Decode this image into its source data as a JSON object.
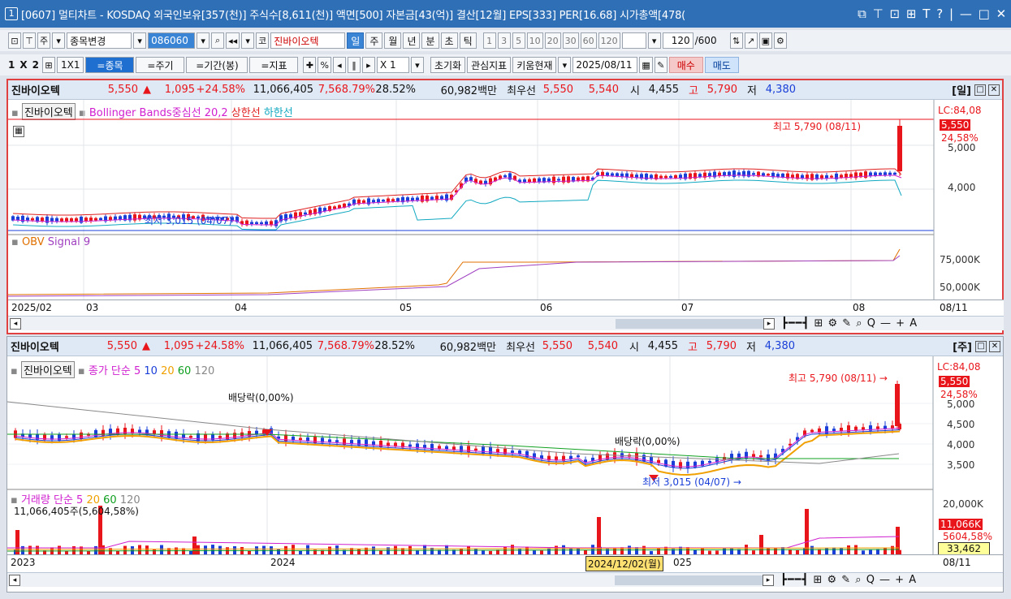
{
  "window": {
    "num": "1",
    "title": "[0607] 멀티차트 - KOSDAQ 외국인보유[357(천)] 주식수[8,611(천)] 액면[500] 자본금[43(억)] 결산[12월] EPS[333] PER[16.68] 시가총액[478(",
    "controls": [
      "⧉",
      "⊤",
      "⊡",
      "⊞",
      "T",
      "?",
      "|",
      "—",
      "□",
      "✕"
    ]
  },
  "toolbar1": {
    "market": "주",
    "change_label": "종목변경",
    "code": "086060",
    "market_btn": "코",
    "stock_name": "진바이오텍",
    "periods": [
      "일",
      "주",
      "월",
      "년",
      "분",
      "초",
      "틱"
    ],
    "active_period": "일",
    "numbers": [
      "1",
      "3",
      "5",
      "10",
      "20",
      "30",
      "60",
      "120"
    ],
    "count": "120",
    "count_total": "/600"
  },
  "toolbar2": {
    "layout": [
      "1",
      "X",
      "2"
    ],
    "onebyone": "1X1",
    "eq_stock": "=종목",
    "eq_period": "=주기",
    "eq_range": "=기간(봉)",
    "eq_indicator": "=지표",
    "percent": "%",
    "multiplier": "X 1",
    "reset": "초기화",
    "watch": "관심지표",
    "kiwoom": "키움현재",
    "date": "2025/08/11",
    "buy": "매수",
    "sell": "매도"
  },
  "quote": {
    "name": "진바이오텍",
    "price": "5,550",
    "arrow": "▲",
    "change": "1,095",
    "pct": "+24.58%",
    "volume": "11,066,405",
    "vol_ratio": "7,568.79%",
    "turnover": "28.52%",
    "amount": "60,982백만",
    "best_label": "최우선",
    "best_ask": "5,550",
    "best_bid": "5,540",
    "open_label": "시",
    "open": "4,455",
    "high_label": "고",
    "high": "5,790",
    "low_label": "저",
    "low": "4,380"
  },
  "panel1": {
    "period_tag": "[일]",
    "legend_name": "진바이오텍",
    "legend_bb": "Bollinger Bands중심선 20,2",
    "legend_upper": "상한선",
    "legend_lower": "하한선",
    "lc_label": "LC:84,08",
    "price_tag": "5,550",
    "pct_tag": "24,58%",
    "y_labels": [
      "5,000",
      "4,000"
    ],
    "max_note": "최고 5,790 (08/11)",
    "min_note": "최저 3,015 (04/07)",
    "obv_label": "OBV",
    "signal_label": "Signal 9",
    "obv_y": [
      "75,000K",
      "50,000K"
    ],
    "x_labels": [
      "2025/02",
      "03",
      "04",
      "05",
      "06",
      "07",
      "08",
      "08/11"
    ]
  },
  "panel2": {
    "period_tag": "[주]",
    "legend_name": "진바이오텍",
    "legend_ma": "종가 단순 5",
    "ma10": "10",
    "ma20": "20",
    "ma60": "60",
    "ma120": "120",
    "lc_label": "LC:84,08",
    "price_tag": "5,550",
    "pct_tag": "24,58%",
    "y_labels": [
      "5,000",
      "4,500",
      "4,000",
      "3,500"
    ],
    "max_note": "최고 5,790 (08/11) →",
    "min_note": "최저 3,015 (04/07) →",
    "div1": "배당락(0,00%)",
    "div2": "배당락(0,00%)",
    "vol_label": "거래량",
    "vol_ma": "단순 5",
    "vol20": "20",
    "vol60": "60",
    "vol120": "120",
    "vol_value": "11,066,405주(5,604,58%)",
    "vol_y": "20,000K",
    "vol_tag": "11,066K",
    "vol_pct_tag": "5604,58%",
    "vol_box": "33,462",
    "cursor_date": "2024/12/02(월)",
    "x_labels": [
      "2023",
      "2024",
      "025",
      "08/11"
    ]
  },
  "scroll_icons": "┣━━┫ ⊞ ⚙ ✎ ⌕ Q — + A",
  "colors": {
    "up": "#e8161b",
    "down": "#1a3fd8",
    "title": "#2f6fb6",
    "bb_upper": "#e02020",
    "bb_center": "#d020d0",
    "bb_lower": "#10a8c0"
  }
}
